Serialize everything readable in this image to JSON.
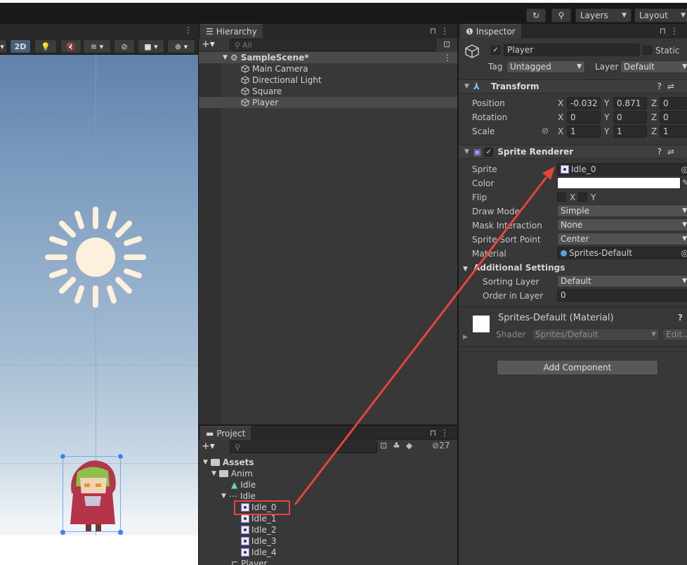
{
  "topbar": {
    "history_icon": "history-icon",
    "search_icon": "search-icon",
    "layers_label": "Layers",
    "layout_label": "Layout"
  },
  "scene_toolbar": {
    "mode_2d_label": "2D"
  },
  "hierarchy": {
    "tab_label": "Hierarchy",
    "search_placeholder": "All",
    "scene_name": "SampleScene*",
    "items": [
      {
        "label": "Main Camera"
      },
      {
        "label": "Directional Light"
      },
      {
        "label": "Square"
      },
      {
        "label": "Player"
      }
    ]
  },
  "project": {
    "tab_label": "Project",
    "hidden_count": "27",
    "tree": [
      {
        "label": "Assets"
      },
      {
        "label": "Anim"
      },
      {
        "label": "Idle"
      },
      {
        "label": "Idle"
      },
      {
        "label": "Idle_0"
      },
      {
        "label": "Idle_1"
      },
      {
        "label": "Idle_2"
      },
      {
        "label": "Idle_3"
      },
      {
        "label": "Idle_4"
      },
      {
        "label": "Player"
      }
    ]
  },
  "inspector": {
    "tab_label": "Inspector",
    "object_name": "Player",
    "static_label": "Static",
    "tag_label": "Tag",
    "tag_value": "Untagged",
    "layer_label": "Layer",
    "layer_value": "Default",
    "transform": {
      "title": "Transform",
      "position_label": "Position",
      "rotation_label": "Rotation",
      "scale_label": "Scale",
      "position": {
        "x": "-0.032",
        "y": "0.871",
        "z": "0"
      },
      "rotation": {
        "x": "0",
        "y": "0",
        "z": "0"
      },
      "scale": {
        "x": "1",
        "y": "1",
        "z": "1"
      },
      "x_label": "X",
      "y_label": "Y",
      "z_label": "Z"
    },
    "sprite_renderer": {
      "title": "Sprite Renderer",
      "sprite_label": "Sprite",
      "sprite_value": "Idle_0",
      "color_label": "Color",
      "color_value": "#ffffff",
      "flip_label": "Flip",
      "flip_x": "X",
      "flip_y": "Y",
      "draw_mode_label": "Draw Mode",
      "draw_mode_value": "Simple",
      "mask_label": "Mask Interaction",
      "mask_value": "None",
      "sort_point_label": "Sprite Sort Point",
      "sort_point_value": "Center",
      "material_label": "Material",
      "material_value": "Sprites-Default",
      "additional_label": "Additional Settings",
      "sorting_layer_label": "Sorting Layer",
      "sorting_layer_value": "Default",
      "order_label": "Order in Layer",
      "order_value": "0"
    },
    "material": {
      "title": "Sprites-Default (Material)",
      "shader_label": "Shader",
      "shader_value": "Sprites/Default",
      "edit_label": "Edit..."
    },
    "add_component_label": "Add Component"
  },
  "colors": {
    "annotation_red": "#e8443a",
    "selection": "#4a4a4a"
  }
}
